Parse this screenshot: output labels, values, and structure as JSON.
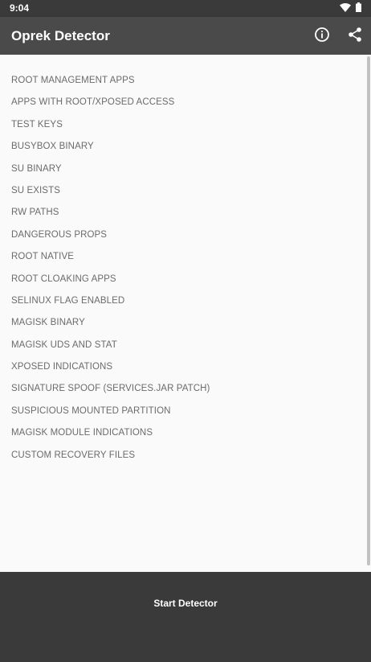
{
  "status_bar": {
    "time": "9:04",
    "icons": [
      "wifi-icon",
      "battery-icon"
    ]
  },
  "app_bar": {
    "title": "Oprek Detector",
    "actions": [
      "info-icon",
      "share-icon"
    ]
  },
  "checks": [
    "ROOT MANAGEMENT APPS",
    "APPS WITH ROOT/XPOSED ACCESS",
    "TEST KEYS",
    "BUSYBOX BINARY",
    "SU BINARY",
    "SU EXISTS",
    "RW PATHS",
    "DANGEROUS PROPS",
    "ROOT NATIVE",
    "ROOT CLOAKING APPS",
    "SELINUX FLAG ENABLED",
    "MAGISK BINARY",
    "MAGISK UDS AND STAT",
    "XPOSED INDICATIONS",
    "SIGNATURE SPOOF (SERVICES.JAR PATCH)",
    "SUSPICIOUS MOUNTED PARTITION",
    "MAGISK MODULE INDICATIONS",
    "CUSTOM RECOVERY FILES"
  ],
  "bottom": {
    "start_label": "Start Detector"
  },
  "colors": {
    "status_bar": "#3a3a3a",
    "app_bar": "#4a4a4a",
    "background": "#fafafa",
    "list_text": "#6b6b6b",
    "bottom_panel": "#3a3a3a"
  }
}
